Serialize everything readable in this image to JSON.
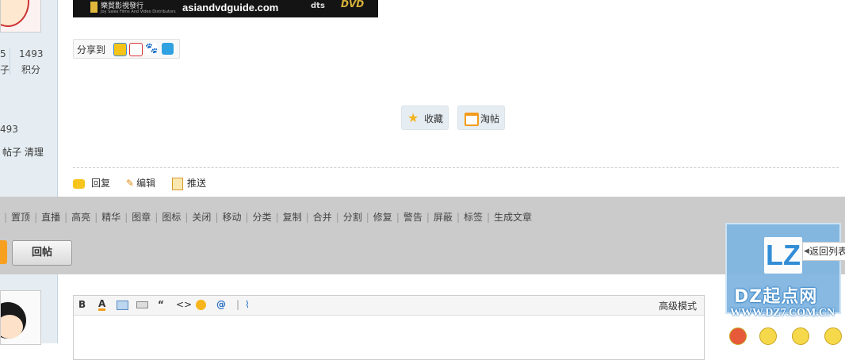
{
  "sidebar_stats": {
    "num1": "5",
    "lbl1": "子",
    "num2": "1493",
    "lbl2": "积分",
    "num3": "493",
    "links": "帖子 清理"
  },
  "ad": {
    "line1": "樂貿影視發行",
    "line2": "Joy Sales Films And Video Distributors",
    "site": "asiandvdguide.com",
    "dts": "dts",
    "dvd": "DVD"
  },
  "share": {
    "label": "分享到"
  },
  "buttons": {
    "favorite": "收藏",
    "taotie": "淘帖"
  },
  "actions": {
    "reply": "回复",
    "edit": "编辑",
    "push": "推送"
  },
  "mod_links": [
    "置顶",
    "直播",
    "高亮",
    "精华",
    "图章",
    "图标",
    "关闭",
    "移动",
    "分类",
    "复制",
    "合并",
    "分割",
    "修复",
    "警告",
    "屏蔽",
    "标签",
    "生成文章"
  ],
  "reply_button": "回帖",
  "editor": {
    "advanced": "高级模式",
    "bold": "B",
    "font_color": "A",
    "quote": "“",
    "code": "<>",
    "at": "@"
  },
  "float": {
    "back_to_list": "返回列表",
    "logo": "LZ",
    "watermark": "DZ起点网",
    "watermark_url": "WWW.DZ7.COM.CN"
  },
  "colors": {
    "sidebar": "#e5edf2",
    "modbar": "#cbcbcb",
    "accent": "#f7a01f",
    "float_bg": "#81b6e2"
  }
}
